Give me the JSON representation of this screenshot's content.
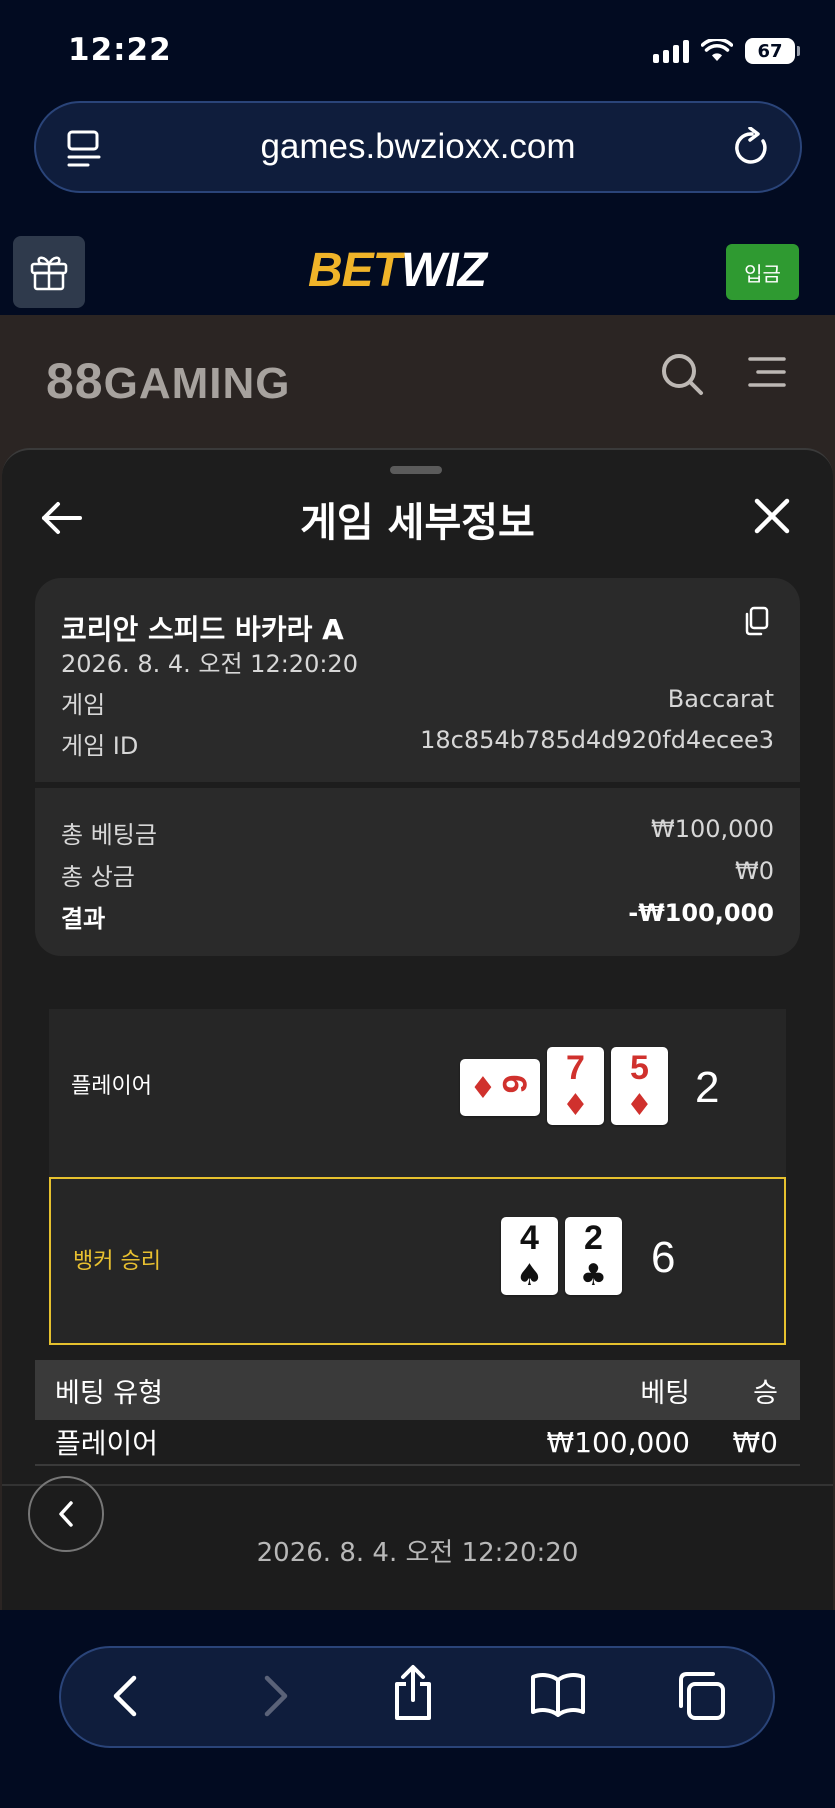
{
  "status_bar": {
    "time": "12:22",
    "battery": "67"
  },
  "browser": {
    "url": "games.bwzioxx.com"
  },
  "site": {
    "logo_bet": "BET",
    "logo_wiz": "WIZ",
    "deposit_label": "입금"
  },
  "game_header": {
    "logo_88": "88",
    "logo_text": "GAMING"
  },
  "sheet": {
    "title": "게임 세부정보",
    "game_name": "코리안 스피드 바카라 A",
    "datetime": "2026. 8. 4. 오전 12:20:20",
    "game_label": "게임",
    "game_value": "Baccarat",
    "game_id_label": "게임 ID",
    "game_id_value": "18c854b785d4d920fd4ecee3",
    "total_bet_label": "총 베팅금",
    "total_bet_value": "₩100,000",
    "total_win_label": "총 상금",
    "total_win_value": "₩0",
    "result_label": "결과",
    "result_value": "-₩100,000"
  },
  "hands": {
    "player": {
      "label": "플레이어",
      "total": "2",
      "cards": [
        {
          "rank": "6",
          "suit": "♦"
        },
        {
          "rank": "7",
          "suit": "♦"
        },
        {
          "rank": "5",
          "suit": "♦"
        }
      ]
    },
    "banker": {
      "label": "뱅커 승리",
      "total": "6",
      "cards": [
        {
          "rank": "4",
          "suit": "♠"
        },
        {
          "rank": "2",
          "suit": "♣"
        }
      ]
    }
  },
  "bet_table": {
    "headers": [
      "베팅 유형",
      "베팅",
      "승"
    ],
    "rows": [
      {
        "type": "플레이어",
        "bet": "₩100,000",
        "win": "₩0"
      }
    ]
  },
  "footer": {
    "date": "2026. 8. 4. 오전 12:20:20"
  },
  "colors": {
    "bg": "#020b21",
    "accent_yellow": "#e6c12e",
    "deposit_green": "#2f9a31",
    "card_red": "#d0312d"
  }
}
